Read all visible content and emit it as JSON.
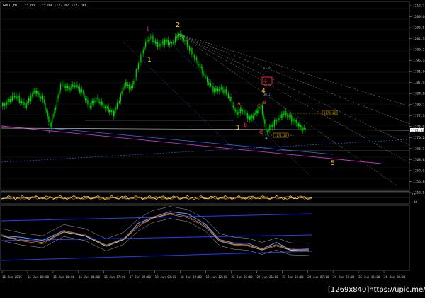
{
  "window": {
    "title": "GOLD,H1  1173.03 1173.09 1172.82 1172.93"
  },
  "main_pane": {
    "price_labels": [
      "1212.74",
      "1209.64",
      "1206.54",
      "1202.34",
      "1199.24",
      "1195.14",
      "1191.04",
      "1187.94",
      "1184.84",
      "1180.74",
      "1177.34",
      "1173.93",
      "1170.24",
      "1166.34",
      "1163.04",
      "1159.94",
      "1156.84",
      "1152.54"
    ],
    "current_price": "1172.93",
    "wave_labels": {
      "w1": "1",
      "w2": "2",
      "w3": "3",
      "w4": "4",
      "w5": "5",
      "wa": "a",
      "wb": "b",
      "wc": "c",
      "wd": "d",
      "we": "e"
    },
    "price_tags": {
      "tag_upper": "1178.40",
      "tag_lower": "1171.30"
    },
    "fan_labels": {
      "fan1": "61.8",
      "fan2": "50.0",
      "fan3": "38.2"
    },
    "box_label": "SL"
  },
  "osc1_pane": {
    "scale": [
      "10",
      "-10"
    ]
  },
  "osc2_pane": {
    "scale": []
  },
  "time_axis": {
    "labels": [
      "11 Jun 2015",
      "15 Jun 08:00",
      "15 Jun 00:00",
      "16 Jun 01:00",
      "16 Jun 17:00",
      "17 Jun 08:00",
      "18 Jun 03:00",
      "18 Jun 19:00",
      "19 Jun 12:00",
      "22 Jun 05:00",
      "22 Jun 21:00",
      "23 Jun 13:00",
      "24 Jun 07:00",
      "24 Jun 23:00",
      "25 Jun 15:00",
      "26 Jun 08:00"
    ]
  },
  "watermark": "[1269x840]https://upic.me/",
  "colors": {
    "candle": "#00e000",
    "wave_yellow": "#ffd200",
    "wave_red": "#ff3030",
    "magenta": "#cc33cc",
    "blue_line": "#3a6cff",
    "fan": "#9a9a9a",
    "grid": "#1c1c1c"
  }
}
